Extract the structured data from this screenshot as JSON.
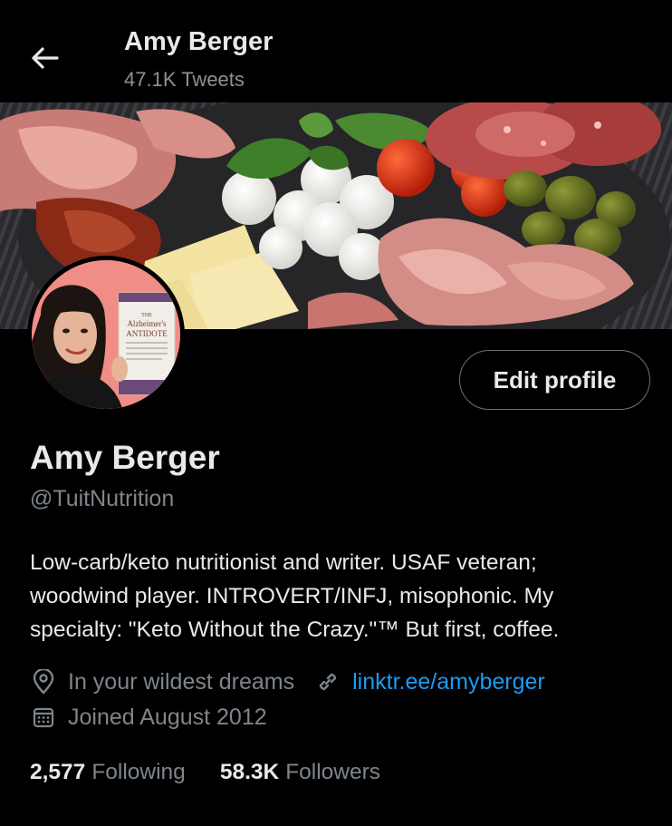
{
  "header": {
    "title": "Amy Berger",
    "subtitle": "47.1K Tweets",
    "back_icon": "arrow-left-icon"
  },
  "profile": {
    "display_name": "Amy Berger",
    "handle": "@TuitNutrition",
    "edit_button_label": "Edit profile",
    "bio_lines": [
      "Low-carb/keto nutritionist and writer. USAF veteran;",
      "woodwind player. INTROVERT/INFJ, misophonic. My",
      "specialty: \"Keto Without the Crazy.\"™ But first, coffee."
    ],
    "location": "In your wildest dreams",
    "website": "linktr.ee/amyberger",
    "joined": "Joined August 2012",
    "book_cover_lines": [
      "THE",
      "Alzheimer's",
      "ANTIDOTE"
    ]
  },
  "stats": {
    "following_count": "2,577",
    "following_label": "Following",
    "followers_count": "58.3K",
    "followers_label": "Followers"
  },
  "colors": {
    "background": "#000000",
    "text_primary": "#e7e9ea",
    "text_secondary": "#7e858b",
    "link": "#1d9bf0",
    "avatar_bg": "#f08d86"
  },
  "icons": {
    "location": "map-pin-icon",
    "website": "link-icon",
    "joined": "calendar-icon"
  }
}
